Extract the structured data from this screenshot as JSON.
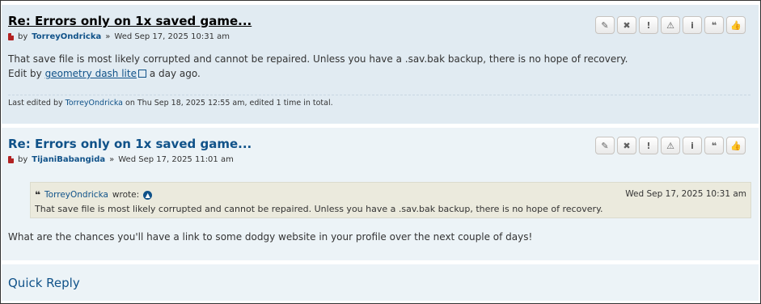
{
  "posts": [
    {
      "title": "Re: Errors only on 1x saved game...",
      "by": "by",
      "author": "TorreyOndricka",
      "sep": "»",
      "date": "Wed Sep 17, 2025 10:31 am",
      "body": "That save file is most likely corrupted and cannot be repaired. Unless you have a .sav.bak backup, there is no hope of recovery.",
      "edit_prefix": "Edit by",
      "edit_link": "geometry dash lite",
      "edit_suffix": "a day ago.",
      "last_edited_prefix": "Last edited by",
      "last_edited_by": "TorreyOndricka",
      "last_edited_suffix": "on Thu Sep 18, 2025 12:55 am, edited 1 time in total."
    },
    {
      "title": "Re: Errors only on 1x saved game...",
      "by": "by",
      "author": "TijaniBabangida",
      "sep": "»",
      "date": "Wed Sep 17, 2025 11:01 am",
      "quote": {
        "author": "TorreyOndricka",
        "wrote": "wrote:",
        "date": "Wed Sep 17, 2025 10:31 am",
        "text": "That save file is most likely corrupted and cannot be repaired. Unless you have a .sav.bak backup, there is no hope of recovery."
      },
      "body": "What are the chances you'll have a link to some dodgy website in your profile over the next couple of days!"
    }
  ],
  "buttons": {
    "edit": "✎",
    "delete": "✖",
    "report": "!",
    "warn": "⚠",
    "info": "i",
    "quote": "❝",
    "like": "👍"
  },
  "quick_reply": "Quick Reply",
  "icons": [
    "edit-icon",
    "delete-icon",
    "report-icon",
    "warn-icon",
    "info-icon",
    "quote-icon",
    "thumbs-up-icon",
    "file-icon",
    "external-link-icon",
    "arrow-up-icon"
  ]
}
